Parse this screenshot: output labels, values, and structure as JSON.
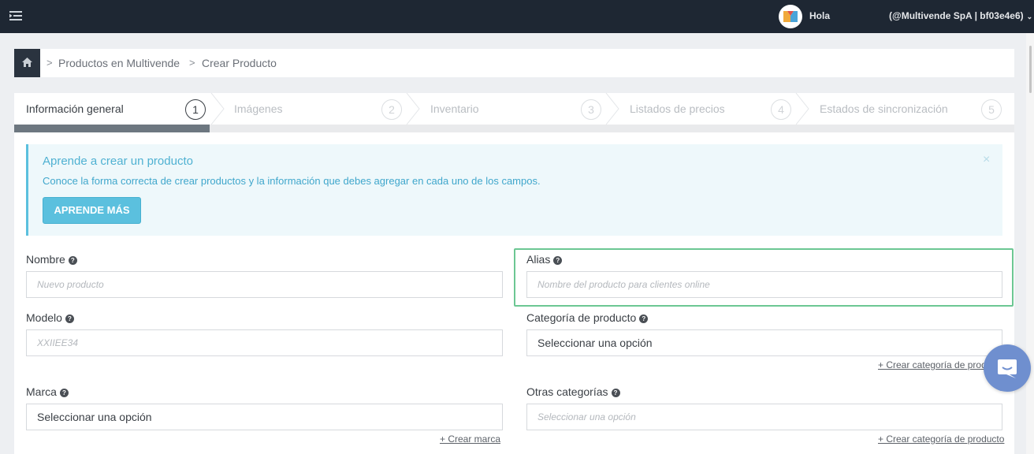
{
  "header": {
    "greeting": "Hola",
    "account": "(@Multivende SpA | bf03e4e6)"
  },
  "breadcrumb": {
    "items": [
      "Productos en Multivende",
      "Crear Producto"
    ],
    "separator": ">"
  },
  "wizard": {
    "steps": [
      {
        "label": "Información general",
        "number": "1",
        "active": true
      },
      {
        "label": "Imágenes",
        "number": "2",
        "active": false
      },
      {
        "label": "Inventario",
        "number": "3",
        "active": false
      },
      {
        "label": "Listados de precios",
        "number": "4",
        "active": false
      },
      {
        "label": "Estados de sincronización",
        "number": "5",
        "active": false
      }
    ]
  },
  "alert": {
    "title": "Aprende a crear un producto",
    "text": "Conoce la forma correcta de crear productos y la información que debes agregar en cada uno de los campos.",
    "button": "APRENDE MÁS",
    "close": "×"
  },
  "form": {
    "nombre": {
      "label": "Nombre",
      "placeholder": "Nuevo producto"
    },
    "alias": {
      "label": "Alias",
      "placeholder": "Nombre del producto para clientes online"
    },
    "modelo": {
      "label": "Modelo",
      "placeholder": "XXIIEE34"
    },
    "categoria": {
      "label": "Categoría de producto",
      "value": "Seleccionar una opción",
      "link": "+ Crear categoría de producto"
    },
    "marca": {
      "label": "Marca",
      "value": "Seleccionar una opción",
      "link": "+ Crear marca"
    },
    "otras": {
      "label": "Otras categorías",
      "placeholder": "Seleccionar una opción",
      "link": "+ Crear categoría de producto"
    }
  },
  "colors": {
    "topbar": "#1e2733",
    "info": "#5bc0de",
    "highlight": "#6cc793",
    "chat": "#6f8fcf"
  },
  "icons": [
    "menu-icon",
    "home-icon",
    "help-icon",
    "close-icon",
    "chat-icon",
    "chevron-down-icon"
  ]
}
